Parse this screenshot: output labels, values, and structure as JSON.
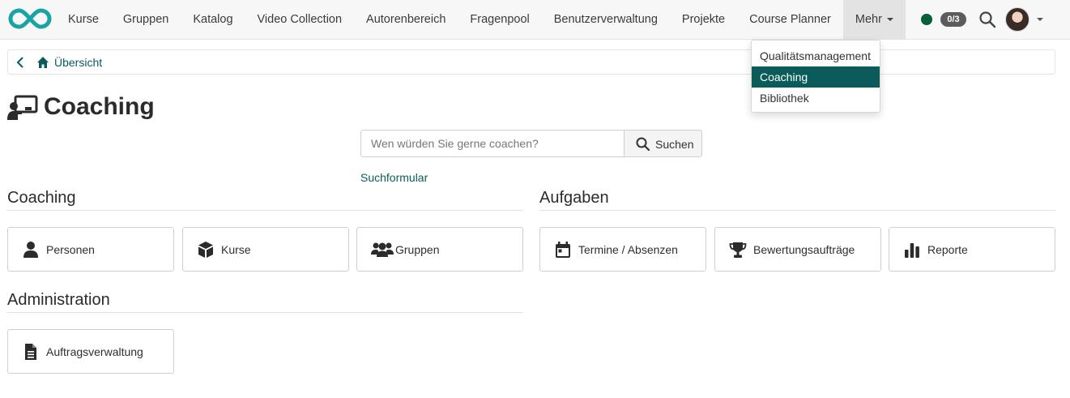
{
  "navbar": {
    "logo": "openolat-infinity-logo",
    "items": [
      {
        "label": "Kurse"
      },
      {
        "label": "Gruppen"
      },
      {
        "label": "Katalog"
      },
      {
        "label": "Video Collection"
      },
      {
        "label": "Autorenbereich"
      },
      {
        "label": "Fragenpool"
      },
      {
        "label": "Benutzerverwaltung"
      },
      {
        "label": "Projekte"
      },
      {
        "label": "Course Planner"
      },
      {
        "label": "Mehr",
        "active": true
      }
    ],
    "status_color": "#075e3a",
    "count_badge": "0/3",
    "search_icon": "search-icon",
    "avatar": "user-avatar"
  },
  "more_menu": {
    "items": [
      {
        "label": "Qualitätsmanagement"
      },
      {
        "label": "Coaching",
        "selected": true
      },
      {
        "label": "Bibliothek"
      }
    ]
  },
  "breadcrumb": {
    "back_icon": "chevron-left-icon",
    "home_icon": "home-icon",
    "label": "Übersicht"
  },
  "page": {
    "title": "Coaching",
    "title_icon": "chalkboard-teacher-icon"
  },
  "search": {
    "placeholder": "Wen würden Sie gerne coachen?",
    "value": "",
    "button_label": "Suchen",
    "link_label": "Suchformular"
  },
  "sections": {
    "coaching": {
      "heading": "Coaching",
      "tiles": [
        {
          "label": "Personen",
          "icon": "user-icon"
        },
        {
          "label": "Kurse",
          "icon": "cube-icon"
        },
        {
          "label": "Gruppen",
          "icon": "users-icon"
        }
      ]
    },
    "aufgaben": {
      "heading": "Aufgaben",
      "tiles": [
        {
          "label": "Termine / Absenzen",
          "icon": "calendar-icon"
        },
        {
          "label": "Bewertungsaufträge",
          "icon": "trophy-icon"
        },
        {
          "label": "Reporte",
          "icon": "bar-chart-icon"
        }
      ]
    },
    "administration": {
      "heading": "Administration",
      "tiles": [
        {
          "label": "Auftragsverwaltung",
          "icon": "file-text-icon"
        }
      ]
    }
  },
  "colors": {
    "brand": "#0b5b5b",
    "logo": "#1aa3a3",
    "nav_bg": "#f7f7f7"
  }
}
